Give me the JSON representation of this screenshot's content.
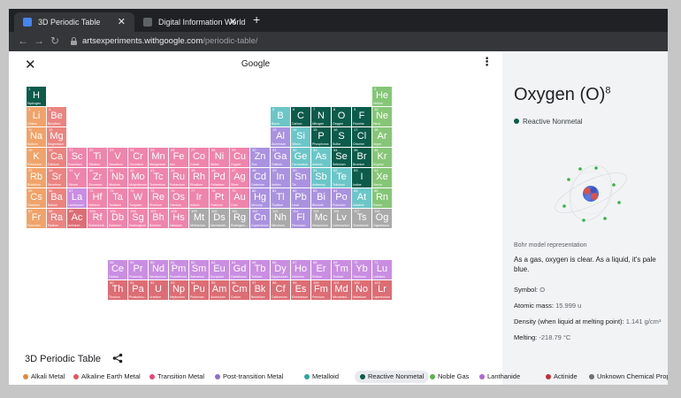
{
  "browser": {
    "tabs": [
      {
        "title": "3D Periodic Table",
        "favicon_color": "#4285f4"
      },
      {
        "title": "Digital Information World",
        "favicon_color": "#5f6368"
      }
    ],
    "new_tab_label": "+",
    "url_host": "artsexperiments.withgoogle.com",
    "url_path": "/periodic-table/"
  },
  "app": {
    "close_label": "✕",
    "title": "Google",
    "more_label": "⋮"
  },
  "categories": {
    "alkali": {
      "label": "Alkali Metal",
      "color": "#e0893c"
    },
    "alkaline": {
      "label": "Alkaline Earth Metal",
      "color": "#e0575c"
    },
    "transition": {
      "label": "Transition Metal",
      "color": "#e8467b"
    },
    "post": {
      "label": "Post-transition Metal",
      "color": "#8d6cd0"
    },
    "metalloid": {
      "label": "Metalloid",
      "color": "#2aa6a2"
    },
    "reactive": {
      "label": "Reactive Nonmetal",
      "color": "#0c5b4b"
    },
    "noble": {
      "label": "Noble Gas",
      "color": "#5cb04d"
    },
    "lanthanide": {
      "label": "Lanthanide",
      "color": "#b164d8"
    },
    "actinide": {
      "label": "Actinide",
      "color": "#c4303a"
    },
    "unknown": {
      "label": "Unknown Chemical Properties",
      "color": "#707070"
    }
  },
  "tile_colors": {
    "alkali": "#f0a36a",
    "alkaline": "#eb8480",
    "transition": "#ef85ab",
    "post": "#aa92e0",
    "metalloid": "#6cc6c8",
    "reactive": "#0c5b4b",
    "noble": "#86c677",
    "lanthanide": "#c98ee2",
    "actinide": "#dd6d74",
    "unknown": "#aaaaaa"
  },
  "elements": [
    {
      "n": 1,
      "s": "H",
      "name": "Hydrogen",
      "cat": "reactive",
      "r": 1,
      "c": 1
    },
    {
      "n": 2,
      "s": "He",
      "name": "Helium",
      "cat": "noble",
      "r": 1,
      "c": 18
    },
    {
      "n": 3,
      "s": "Li",
      "name": "Lithium",
      "cat": "alkali",
      "r": 2,
      "c": 1
    },
    {
      "n": 4,
      "s": "Be",
      "name": "Beryllium",
      "cat": "alkaline",
      "r": 2,
      "c": 2
    },
    {
      "n": 5,
      "s": "B",
      "name": "Boron",
      "cat": "metalloid",
      "r": 2,
      "c": 13
    },
    {
      "n": 6,
      "s": "C",
      "name": "Carbon",
      "cat": "reactive",
      "r": 2,
      "c": 14
    },
    {
      "n": 7,
      "s": "N",
      "name": "Nitrogen",
      "cat": "reactive",
      "r": 2,
      "c": 15
    },
    {
      "n": 8,
      "s": "O",
      "name": "Oxygen",
      "cat": "reactive",
      "r": 2,
      "c": 16
    },
    {
      "n": 9,
      "s": "F",
      "name": "Fluorine",
      "cat": "reactive",
      "r": 2,
      "c": 17
    },
    {
      "n": 10,
      "s": "Ne",
      "name": "Neon",
      "cat": "noble",
      "r": 2,
      "c": 18
    },
    {
      "n": 11,
      "s": "Na",
      "name": "Sodium",
      "cat": "alkali",
      "r": 3,
      "c": 1
    },
    {
      "n": 12,
      "s": "Mg",
      "name": "Magnesium",
      "cat": "alkaline",
      "r": 3,
      "c": 2
    },
    {
      "n": 13,
      "s": "Al",
      "name": "Aluminium",
      "cat": "post",
      "r": 3,
      "c": 13
    },
    {
      "n": 14,
      "s": "Si",
      "name": "Silicon",
      "cat": "metalloid",
      "r": 3,
      "c": 14
    },
    {
      "n": 15,
      "s": "P",
      "name": "Phosphorus",
      "cat": "reactive",
      "r": 3,
      "c": 15
    },
    {
      "n": 16,
      "s": "S",
      "name": "Sulfur",
      "cat": "reactive",
      "r": 3,
      "c": 16
    },
    {
      "n": 17,
      "s": "Cl",
      "name": "Chlorine",
      "cat": "reactive",
      "r": 3,
      "c": 17
    },
    {
      "n": 18,
      "s": "Ar",
      "name": "Argon",
      "cat": "noble",
      "r": 3,
      "c": 18
    },
    {
      "n": 19,
      "s": "K",
      "name": "Potassium",
      "cat": "alkali",
      "r": 4,
      "c": 1
    },
    {
      "n": 20,
      "s": "Ca",
      "name": "Calcium",
      "cat": "alkaline",
      "r": 4,
      "c": 2
    },
    {
      "n": 21,
      "s": "Sc",
      "name": "Scandium",
      "cat": "transition",
      "r": 4,
      "c": 3
    },
    {
      "n": 22,
      "s": "Ti",
      "name": "Titanium",
      "cat": "transition",
      "r": 4,
      "c": 4
    },
    {
      "n": 23,
      "s": "V",
      "name": "Vanadium",
      "cat": "transition",
      "r": 4,
      "c": 5
    },
    {
      "n": 24,
      "s": "Cr",
      "name": "Chromium",
      "cat": "transition",
      "r": 4,
      "c": 6
    },
    {
      "n": 25,
      "s": "Mn",
      "name": "Manganese",
      "cat": "transition",
      "r": 4,
      "c": 7
    },
    {
      "n": 26,
      "s": "Fe",
      "name": "Iron",
      "cat": "transition",
      "r": 4,
      "c": 8
    },
    {
      "n": 27,
      "s": "Co",
      "name": "Cobalt",
      "cat": "transition",
      "r": 4,
      "c": 9
    },
    {
      "n": 28,
      "s": "Ni",
      "name": "Nickel",
      "cat": "transition",
      "r": 4,
      "c": 10
    },
    {
      "n": 29,
      "s": "Cu",
      "name": "Copper",
      "cat": "transition",
      "r": 4,
      "c": 11
    },
    {
      "n": 30,
      "s": "Zn",
      "name": "Zinc",
      "cat": "post",
      "r": 4,
      "c": 12
    },
    {
      "n": 31,
      "s": "Ga",
      "name": "Gallium",
      "cat": "post",
      "r": 4,
      "c": 13
    },
    {
      "n": 32,
      "s": "Ge",
      "name": "Germanium",
      "cat": "metalloid",
      "r": 4,
      "c": 14
    },
    {
      "n": 33,
      "s": "As",
      "name": "Arsenic",
      "cat": "metalloid",
      "r": 4,
      "c": 15
    },
    {
      "n": 34,
      "s": "Se",
      "name": "Selenium",
      "cat": "reactive",
      "r": 4,
      "c": 16
    },
    {
      "n": 35,
      "s": "Br",
      "name": "Bromine",
      "cat": "reactive",
      "r": 4,
      "c": 17
    },
    {
      "n": 36,
      "s": "Kr",
      "name": "Krypton",
      "cat": "noble",
      "r": 4,
      "c": 18
    },
    {
      "n": 37,
      "s": "Rb",
      "name": "Rubidium",
      "cat": "alkali",
      "r": 5,
      "c": 1
    },
    {
      "n": 38,
      "s": "Sr",
      "name": "Strontium",
      "cat": "alkaline",
      "r": 5,
      "c": 2
    },
    {
      "n": 39,
      "s": "Y",
      "name": "Yttrium",
      "cat": "transition",
      "r": 5,
      "c": 3
    },
    {
      "n": 40,
      "s": "Zr",
      "name": "Zirconium",
      "cat": "transition",
      "r": 5,
      "c": 4
    },
    {
      "n": 41,
      "s": "Nb",
      "name": "Niobium",
      "cat": "transition",
      "r": 5,
      "c": 5
    },
    {
      "n": 42,
      "s": "Mo",
      "name": "Molybdenum",
      "cat": "transition",
      "r": 5,
      "c": 6
    },
    {
      "n": 43,
      "s": "Tc",
      "name": "Technetium",
      "cat": "transition",
      "r": 5,
      "c": 7
    },
    {
      "n": 44,
      "s": "Ru",
      "name": "Ruthenium",
      "cat": "transition",
      "r": 5,
      "c": 8
    },
    {
      "n": 45,
      "s": "Rh",
      "name": "Rhodium",
      "cat": "transition",
      "r": 5,
      "c": 9
    },
    {
      "n": 46,
      "s": "Pd",
      "name": "Palladium",
      "cat": "transition",
      "r": 5,
      "c": 10
    },
    {
      "n": 47,
      "s": "Ag",
      "name": "Silver",
      "cat": "transition",
      "r": 5,
      "c": 11
    },
    {
      "n": 48,
      "s": "Cd",
      "name": "Cadmium",
      "cat": "post",
      "r": 5,
      "c": 12
    },
    {
      "n": 49,
      "s": "In",
      "name": "Indium",
      "cat": "post",
      "r": 5,
      "c": 13
    },
    {
      "n": 50,
      "s": "Sn",
      "name": "Tin",
      "cat": "post",
      "r": 5,
      "c": 14
    },
    {
      "n": 51,
      "s": "Sb",
      "name": "Antimony",
      "cat": "metalloid",
      "r": 5,
      "c": 15
    },
    {
      "n": 52,
      "s": "Te",
      "name": "Tellurium",
      "cat": "metalloid",
      "r": 5,
      "c": 16
    },
    {
      "n": 53,
      "s": "I",
      "name": "Iodine",
      "cat": "reactive",
      "r": 5,
      "c": 17
    },
    {
      "n": 54,
      "s": "Xe",
      "name": "Xenon",
      "cat": "noble",
      "r": 5,
      "c": 18
    },
    {
      "n": 55,
      "s": "Cs",
      "name": "Caesium",
      "cat": "alkali",
      "r": 6,
      "c": 1
    },
    {
      "n": 56,
      "s": "Ba",
      "name": "Barium",
      "cat": "alkaline",
      "r": 6,
      "c": 2
    },
    {
      "n": 57,
      "s": "La",
      "name": "Lanthanum",
      "cat": "lanthanide",
      "r": 6,
      "c": 3
    },
    {
      "n": 72,
      "s": "Hf",
      "name": "Hafnium",
      "cat": "transition",
      "r": 6,
      "c": 4
    },
    {
      "n": 73,
      "s": "Ta",
      "name": "Tantalum",
      "cat": "transition",
      "r": 6,
      "c": 5
    },
    {
      "n": 74,
      "s": "W",
      "name": "Tungsten",
      "cat": "transition",
      "r": 6,
      "c": 6
    },
    {
      "n": 75,
      "s": "Re",
      "name": "Rhenium",
      "cat": "transition",
      "r": 6,
      "c": 7
    },
    {
      "n": 76,
      "s": "Os",
      "name": "Osmium",
      "cat": "transition",
      "r": 6,
      "c": 8
    },
    {
      "n": 77,
      "s": "Ir",
      "name": "Iridium",
      "cat": "transition",
      "r": 6,
      "c": 9
    },
    {
      "n": 78,
      "s": "Pt",
      "name": "Platinum",
      "cat": "transition",
      "r": 6,
      "c": 10
    },
    {
      "n": 79,
      "s": "Au",
      "name": "Gold",
      "cat": "transition",
      "r": 6,
      "c": 11
    },
    {
      "n": 80,
      "s": "Hg",
      "name": "Mercury",
      "cat": "post",
      "r": 6,
      "c": 12
    },
    {
      "n": 81,
      "s": "Tl",
      "name": "Thallium",
      "cat": "post",
      "r": 6,
      "c": 13
    },
    {
      "n": 82,
      "s": "Pb",
      "name": "Lead",
      "cat": "post",
      "r": 6,
      "c": 14
    },
    {
      "n": 83,
      "s": "Bi",
      "name": "Bismuth",
      "cat": "post",
      "r": 6,
      "c": 15
    },
    {
      "n": 84,
      "s": "Po",
      "name": "Polonium",
      "cat": "post",
      "r": 6,
      "c": 16
    },
    {
      "n": 85,
      "s": "At",
      "name": "Astatine",
      "cat": "metalloid",
      "r": 6,
      "c": 17
    },
    {
      "n": 86,
      "s": "Rn",
      "name": "Radon",
      "cat": "noble",
      "r": 6,
      "c": 18
    },
    {
      "n": 87,
      "s": "Fr",
      "name": "Francium",
      "cat": "alkali",
      "r": 7,
      "c": 1
    },
    {
      "n": 88,
      "s": "Ra",
      "name": "Radium",
      "cat": "alkaline",
      "r": 7,
      "c": 2
    },
    {
      "n": 89,
      "s": "Ac",
      "name": "Actinium",
      "cat": "actinide",
      "r": 7,
      "c": 3
    },
    {
      "n": 104,
      "s": "Rf",
      "name": "Rutherfordi...",
      "cat": "transition",
      "r": 7,
      "c": 4
    },
    {
      "n": 105,
      "s": "Db",
      "name": "Dubnium",
      "cat": "transition",
      "r": 7,
      "c": 5
    },
    {
      "n": 106,
      "s": "Sg",
      "name": "Seaborgium",
      "cat": "transition",
      "r": 7,
      "c": 6
    },
    {
      "n": 107,
      "s": "Bh",
      "name": "Bohrium",
      "cat": "transition",
      "r": 7,
      "c": 7
    },
    {
      "n": 108,
      "s": "Hs",
      "name": "Hassium",
      "cat": "transition",
      "r": 7,
      "c": 8
    },
    {
      "n": 109,
      "s": "Mt",
      "name": "Meitnerium",
      "cat": "unknown",
      "r": 7,
      "c": 9
    },
    {
      "n": 110,
      "s": "Ds",
      "name": "Darmstadti...",
      "cat": "unknown",
      "r": 7,
      "c": 10
    },
    {
      "n": 111,
      "s": "Rg",
      "name": "Roentgeni...",
      "cat": "unknown",
      "r": 7,
      "c": 11
    },
    {
      "n": 112,
      "s": "Cn",
      "name": "Copernicium",
      "cat": "post",
      "r": 7,
      "c": 12
    },
    {
      "n": 113,
      "s": "Nh",
      "name": "Nihonium",
      "cat": "unknown",
      "r": 7,
      "c": 13
    },
    {
      "n": 114,
      "s": "Fl",
      "name": "Flerovium",
      "cat": "post",
      "r": 7,
      "c": 14
    },
    {
      "n": 115,
      "s": "Mc",
      "name": "Moscovium",
      "cat": "unknown",
      "r": 7,
      "c": 15
    },
    {
      "n": 116,
      "s": "Lv",
      "name": "Livermorium",
      "cat": "unknown",
      "r": 7,
      "c": 16
    },
    {
      "n": 117,
      "s": "Ts",
      "name": "Tennessine",
      "cat": "unknown",
      "r": 7,
      "c": 17
    },
    {
      "n": 118,
      "s": "Og",
      "name": "Oganesson",
      "cat": "unknown",
      "r": 7,
      "c": 18
    },
    {
      "n": 58,
      "s": "Ce",
      "name": "Cerium",
      "cat": "lanthanide",
      "r": 9,
      "c": 5
    },
    {
      "n": 59,
      "s": "Pr",
      "name": "Praseody...",
      "cat": "lanthanide",
      "r": 9,
      "c": 6
    },
    {
      "n": 60,
      "s": "Nd",
      "name": "Neodymium",
      "cat": "lanthanide",
      "r": 9,
      "c": 7
    },
    {
      "n": 61,
      "s": "Pm",
      "name": "Promethium",
      "cat": "lanthanide",
      "r": 9,
      "c": 8
    },
    {
      "n": 62,
      "s": "Sm",
      "name": "Samarium",
      "cat": "lanthanide",
      "r": 9,
      "c": 9
    },
    {
      "n": 63,
      "s": "Eu",
      "name": "Europium",
      "cat": "lanthanide",
      "r": 9,
      "c": 10
    },
    {
      "n": 64,
      "s": "Gd",
      "name": "Gadolinium",
      "cat": "lanthanide",
      "r": 9,
      "c": 11
    },
    {
      "n": 65,
      "s": "Tb",
      "name": "Terbium",
      "cat": "lanthanide",
      "r": 9,
      "c": 12
    },
    {
      "n": 66,
      "s": "Dy",
      "name": "Dysprosium",
      "cat": "lanthanide",
      "r": 9,
      "c": 13
    },
    {
      "n": 67,
      "s": "Ho",
      "name": "Holmium",
      "cat": "lanthanide",
      "r": 9,
      "c": 14
    },
    {
      "n": 68,
      "s": "Er",
      "name": "Erbium",
      "cat": "lanthanide",
      "r": 9,
      "c": 15
    },
    {
      "n": 69,
      "s": "Tm",
      "name": "Thulium",
      "cat": "lanthanide",
      "r": 9,
      "c": 16
    },
    {
      "n": 70,
      "s": "Yb",
      "name": "Ytterbium",
      "cat": "lanthanide",
      "r": 9,
      "c": 17
    },
    {
      "n": 71,
      "s": "Lu",
      "name": "Lutetium",
      "cat": "lanthanide",
      "r": 9,
      "c": 18
    },
    {
      "n": 90,
      "s": "Th",
      "name": "Thorium",
      "cat": "actinide",
      "r": 10,
      "c": 5
    },
    {
      "n": 91,
      "s": "Pa",
      "name": "Protactiniu...",
      "cat": "actinide",
      "r": 10,
      "c": 6
    },
    {
      "n": 92,
      "s": "U",
      "name": "Uranium",
      "cat": "actinide",
      "r": 10,
      "c": 7
    },
    {
      "n": 93,
      "s": "Np",
      "name": "Neptunium",
      "cat": "actinide",
      "r": 10,
      "c": 8
    },
    {
      "n": 94,
      "s": "Pu",
      "name": "Plutonium",
      "cat": "actinide",
      "r": 10,
      "c": 9
    },
    {
      "n": 95,
      "s": "Am",
      "name": "Americium",
      "cat": "actinide",
      "r": 10,
      "c": 10
    },
    {
      "n": 96,
      "s": "Cm",
      "name": "Curium",
      "cat": "actinide",
      "r": 10,
      "c": 11
    },
    {
      "n": 97,
      "s": "Bk",
      "name": "Berkelium",
      "cat": "actinide",
      "r": 10,
      "c": 12
    },
    {
      "n": 98,
      "s": "Cf",
      "name": "Californium",
      "cat": "actinide",
      "r": 10,
      "c": 13
    },
    {
      "n": 99,
      "s": "Es",
      "name": "Einsteinium",
      "cat": "actinide",
      "r": 10,
      "c": 14
    },
    {
      "n": 100,
      "s": "Fm",
      "name": "Fermium",
      "cat": "actinide",
      "r": 10,
      "c": 15
    },
    {
      "n": 101,
      "s": "Md",
      "name": "Mendelevi...",
      "cat": "actinide",
      "r": 10,
      "c": 16
    },
    {
      "n": 102,
      "s": "No",
      "name": "Nobelium",
      "cat": "actinide",
      "r": 10,
      "c": 17
    },
    {
      "n": 103,
      "s": "Lr",
      "name": "Lawrencium",
      "cat": "actinide",
      "r": 10,
      "c": 18
    }
  ],
  "detail": {
    "title": "Oxygen (O)",
    "atomic_number": "8",
    "category_label": "Reactive Nonmetal",
    "category_color": "#0c5b4b",
    "bohr_caption": "Bohr model representation",
    "description": "As a gas, oxygen is clear. As a liquid, it's pale blue.",
    "props": [
      {
        "label": "Symbol:",
        "value": "O"
      },
      {
        "label": "Atomic mass:",
        "value": "15.999 u"
      },
      {
        "label": "Density (when liquid at melting point):",
        "value": "1.141 g/cm³"
      },
      {
        "label": "Melting:",
        "value": "-218.79 °C"
      }
    ]
  },
  "footer": {
    "title": "3D Periodic Table",
    "legend_order": [
      "alkali",
      "alkaline",
      "transition",
      "post",
      "metalloid",
      "reactive",
      "noble",
      "lanthanide",
      "actinide",
      "unknown"
    ],
    "selected": "reactive"
  }
}
